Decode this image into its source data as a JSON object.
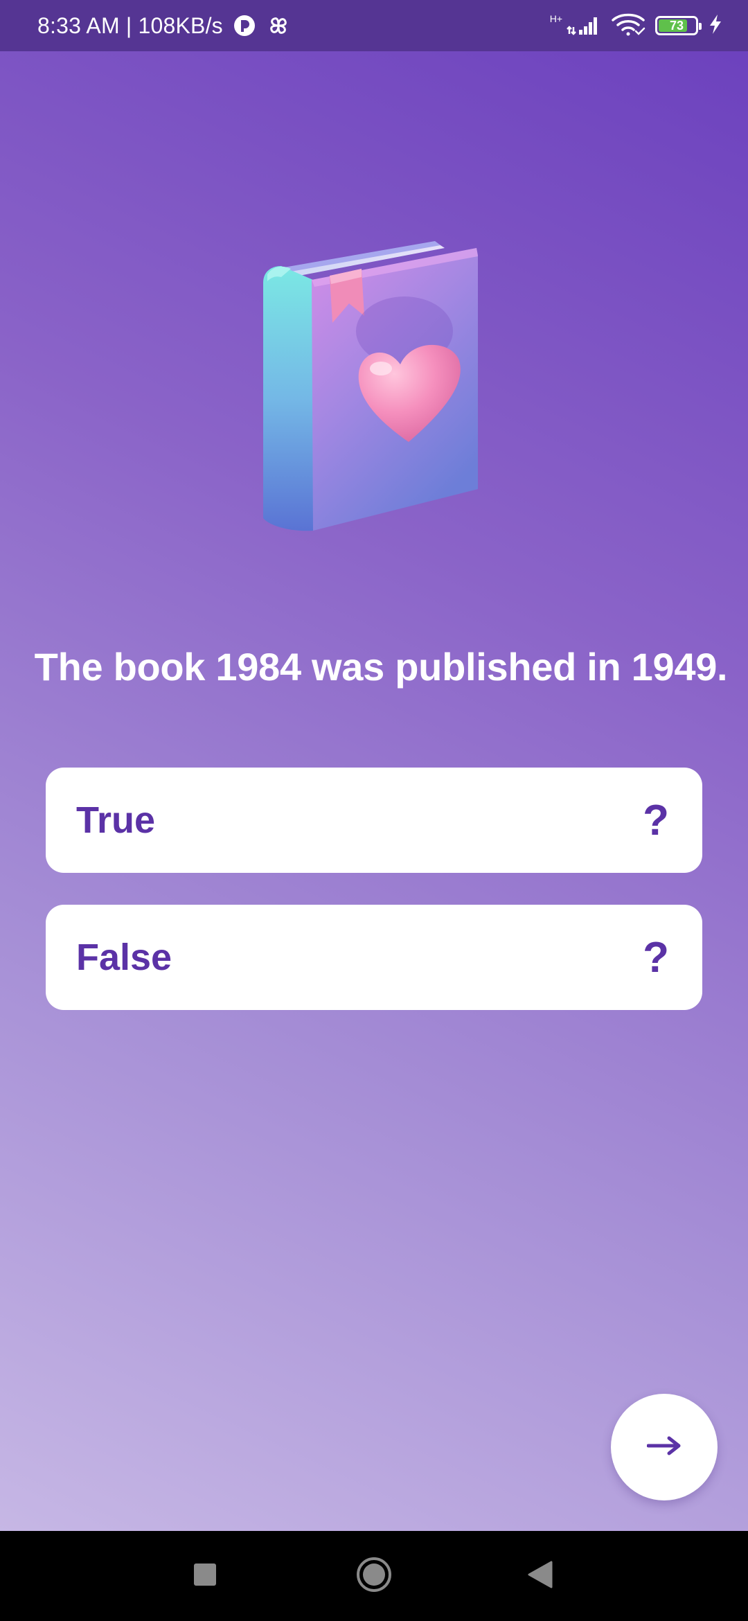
{
  "status_bar": {
    "time_speed": "8:33 AM | 108KB/s",
    "network_type": "H+",
    "battery_level": "73",
    "icons": [
      "notification-app-icon",
      "pinwheel-app-icon",
      "signal-icon",
      "wifi-icon",
      "battery-icon",
      "charging-bolt-icon"
    ]
  },
  "illustration": {
    "icon": "book-with-heart-icon"
  },
  "question": {
    "text": "The book 1984 was published in 1949."
  },
  "options": [
    {
      "label": "True",
      "mark": "?"
    },
    {
      "label": "False",
      "mark": "?"
    }
  ],
  "next_button": {
    "icon": "arrow-right-icon"
  },
  "navigation": {
    "icons": [
      "recents-square-icon",
      "home-circle-icon",
      "back-triangle-icon"
    ]
  },
  "colors": {
    "accent": "#5b32a6",
    "status_bar": "#553593",
    "battery_fill": "#5fc04b",
    "option_background": "#ffffff"
  }
}
